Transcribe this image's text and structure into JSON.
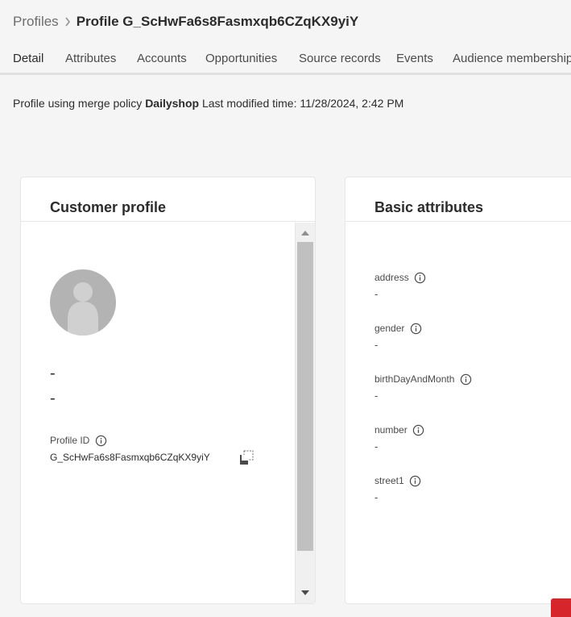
{
  "breadcrumb": {
    "root": "Profiles",
    "current": "Profile G_ScHwFa6s8Fasmxqb6CZqKX9yiY"
  },
  "tabs": [
    {
      "label": "Detail",
      "active": true
    },
    {
      "label": "Attributes",
      "active": false
    },
    {
      "label": "Accounts",
      "active": false
    },
    {
      "label": "Opportunities",
      "active": false
    },
    {
      "label": "Source records",
      "active": false
    },
    {
      "label": "Events",
      "active": false
    },
    {
      "label": "Audience membership",
      "active": false
    }
  ],
  "policy": {
    "prefix": "Profile using merge policy ",
    "name": "Dailyshop",
    "modified_label": " Last modified time: ",
    "modified_value": "11/28/2024, 2:42 PM"
  },
  "customer_profile": {
    "title": "Customer profile",
    "name_line": "-",
    "subtitle_line": "-",
    "profile_id_label": "Profile ID",
    "profile_id_value": "G_ScHwFa6s8Fasmxqb6CZqKX9yiY"
  },
  "basic_attributes": {
    "title": "Basic attributes",
    "items": [
      {
        "label": "address",
        "value": "-"
      },
      {
        "label": "gender",
        "value": "-"
      },
      {
        "label": "birthDayAndMonth",
        "value": "-"
      },
      {
        "label": "number",
        "value": "-"
      },
      {
        "label": "street1",
        "value": "-"
      }
    ]
  },
  "icons": {
    "breadcrumb_separator": "chevron-right-icon",
    "info": "info-icon",
    "copy": "copy-icon",
    "avatar": "user-avatar-icon"
  },
  "colors": {
    "accent_text": "#2c2c2c",
    "muted_text": "#6e6e6e",
    "avatar_bg": "#b3b3b3",
    "badge": "#d7262b"
  }
}
